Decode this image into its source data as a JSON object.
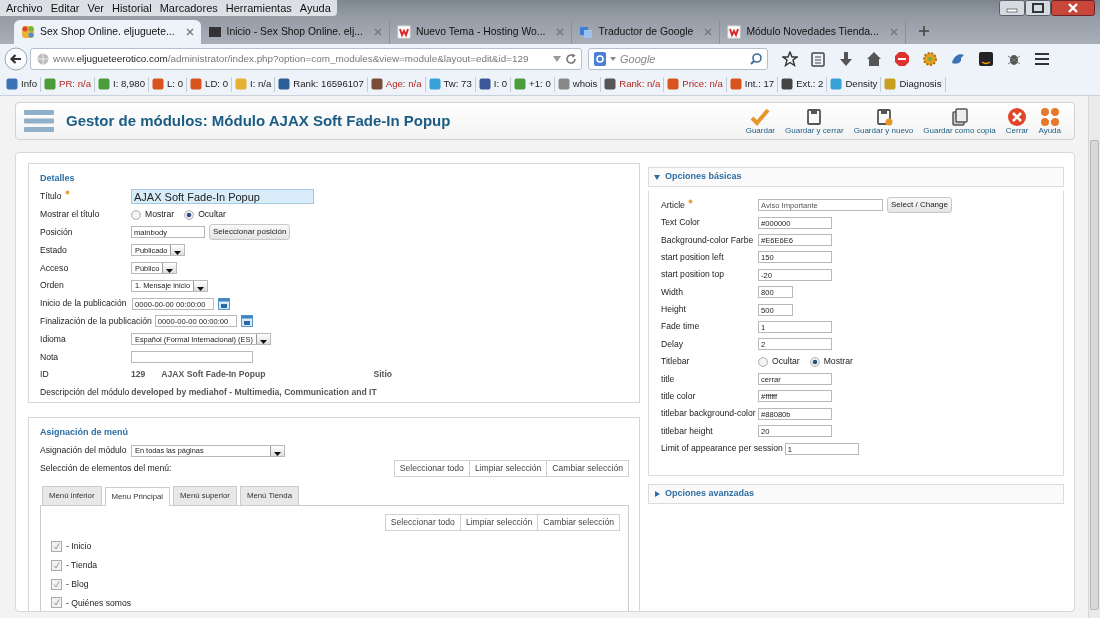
{
  "menu_bar": [
    "Archivo",
    "Editar",
    "Ver",
    "Historial",
    "Marcadores",
    "Herramientas",
    "Ayuda"
  ],
  "tabs": [
    {
      "title": "Sex Shop Online. eljuguete...",
      "selected": true
    },
    {
      "title": "Inicio - Sex Shop Online. elj...",
      "selected": false
    },
    {
      "title": "Nuevo Tema - Hosting Wo...",
      "selected": false
    },
    {
      "title": "Traductor de Google",
      "selected": false
    },
    {
      "title": "Módulo Novedades Tienda...",
      "selected": false
    }
  ],
  "address_bar": {
    "url": "www.**eljugueteerotico.com**/administrator/index.php?option=com_modules&view=module&layout=edit&id=129"
  },
  "search": {
    "placeholder": "Google"
  },
  "addon_bar": [
    {
      "label": "Info",
      "alert": false
    },
    {
      "label": "PR: n/a",
      "alert": true
    },
    {
      "label": "I: 8,980",
      "alert": false
    },
    {
      "label": "L: 0",
      "alert": false
    },
    {
      "label": "LD: 0",
      "alert": false
    },
    {
      "label": "I: n/a",
      "alert": false
    },
    {
      "label": "Rank: 16596107",
      "alert": false
    },
    {
      "label": "Age: n/a",
      "alert": true
    },
    {
      "label": "Tw: 73",
      "alert": false
    },
    {
      "label": "I: 0",
      "alert": false
    },
    {
      "label": "+1: 0",
      "alert": false
    },
    {
      "label": "whois",
      "alert": false
    },
    {
      "label": "Rank: n/a",
      "alert": true
    },
    {
      "label": "Price: n/a",
      "alert": true
    },
    {
      "label": "Int.: 17",
      "alert": false
    },
    {
      "label": "Ext.: 2",
      "alert": false
    },
    {
      "label": "Density",
      "alert": false
    },
    {
      "label": "Diagnosis",
      "alert": false
    }
  ],
  "page": {
    "title": "Gestor de módulos: Módulo AJAX Soft Fade-In Popup",
    "toolbar": [
      {
        "kind": "check",
        "label": "Guardar"
      },
      {
        "kind": "save",
        "label": "Guardar y cerrar"
      },
      {
        "kind": "save-new",
        "label": "Guardar y nuevo"
      },
      {
        "kind": "copy",
        "label": "Guardar como copia"
      },
      {
        "kind": "close",
        "label": "Cerrar"
      },
      {
        "kind": "help",
        "label": "Ayuda"
      }
    ]
  },
  "details": {
    "legend": "Detalles",
    "fields": [
      {
        "kind": "title",
        "label": "Título",
        "required": true,
        "value": "AJAX Soft Fade-In Popup"
      },
      {
        "kind": "radio",
        "label": "Mostrar el título",
        "options": [
          {
            "label": "Mostrar",
            "selected": false
          },
          {
            "label": "Ocultar",
            "selected": true
          }
        ]
      },
      {
        "kind": "text",
        "label": "Posición",
        "value": "mainbody",
        "button": "Seleccionar posición"
      },
      {
        "kind": "select",
        "label": "Estado",
        "value": "Publicado"
      },
      {
        "kind": "select",
        "label": "Acceso",
        "value": "Público"
      },
      {
        "kind": "select",
        "label": "Orden",
        "value": "1. Mensaje inicio"
      },
      {
        "kind": "date",
        "label": "Inicio de la publicación",
        "value": "0000-00-00 00:00:00"
      },
      {
        "kind": "date",
        "label": "Finalización de la publicación",
        "value": "0000-00-00 00:00:00"
      },
      {
        "kind": "select",
        "label": "Idioma",
        "value": "Español (Formal Internacional) (ES)"
      },
      {
        "kind": "text",
        "label": "Nota"
      },
      {
        "kind": "info",
        "label": "ID",
        "values": [
          "129",
          "AJAX Soft Fade-In Popup",
          "Sitio"
        ]
      },
      {
        "kind": "info",
        "label": "Descripción del módulo",
        "values": [
          "developed by mediahof - Multimedia, Communication and IT"
        ]
      }
    ]
  },
  "menu_assignment": {
    "legend": "Asignación de menú",
    "assignment_label": "Asignación del módulo",
    "assignment_value": "En todas las páginas",
    "selection_label": "Selección de elementos del menú:",
    "buttons": [
      "Seleccionar todo",
      "Limpiar selección",
      "Cambiar selección"
    ],
    "tabs": [
      {
        "label": "Menú inferior",
        "selected": false
      },
      {
        "label": "Menu Principal",
        "selected": true
      },
      {
        "label": "Menú superior",
        "selected": false
      },
      {
        "label": "Menú Tienda",
        "selected": false
      }
    ],
    "panel_buttons": [
      "Seleccionar todo",
      "Limpiar selección",
      "Cambiar selección"
    ],
    "items": [
      {
        "label": "- Inicio",
        "checked": true
      },
      {
        "label": "- Tienda",
        "checked": true
      },
      {
        "label": "- Blog",
        "checked": true
      },
      {
        "label": "- Quiénes somos",
        "checked": true
      }
    ]
  },
  "basic_options": {
    "title": "Opciones básicas",
    "expanded": true,
    "fields": [
      {
        "kind": "article",
        "label": "Article",
        "required": true,
        "value": "Aviso Importante",
        "button": "Select / Change"
      },
      {
        "kind": "text",
        "label": "Text Color",
        "value": "#000000"
      },
      {
        "kind": "text",
        "label": "Background-color Farbe",
        "value": "#E6E6E6"
      },
      {
        "kind": "text",
        "label": "start position left",
        "value": "150"
      },
      {
        "kind": "text",
        "label": "start position top",
        "value": "-20"
      },
      {
        "kind": "short",
        "label": "Width",
        "value": "800"
      },
      {
        "kind": "short",
        "label": "Height",
        "value": "500"
      },
      {
        "kind": "text",
        "label": "Fade time",
        "value": "1"
      },
      {
        "kind": "text",
        "label": "Delay",
        "value": "2"
      },
      {
        "kind": "radio",
        "label": "Titlebar",
        "options": [
          {
            "label": "Ocultar",
            "selected": false
          },
          {
            "label": "Mostrar",
            "selected": true
          }
        ]
      },
      {
        "kind": "text",
        "label": "title",
        "value": "cerrar"
      },
      {
        "kind": "text",
        "label": "title color",
        "value": "#ffffff"
      },
      {
        "kind": "text",
        "label": "titlebar background-color",
        "value": "#88080b"
      },
      {
        "kind": "text",
        "label": "titlebar height",
        "value": "20"
      },
      {
        "kind": "wide",
        "label": "Limit of appearance per session",
        "value": "1"
      }
    ]
  },
  "advanced_options": {
    "title": "Opciones avanzadas",
    "expanded": false
  }
}
